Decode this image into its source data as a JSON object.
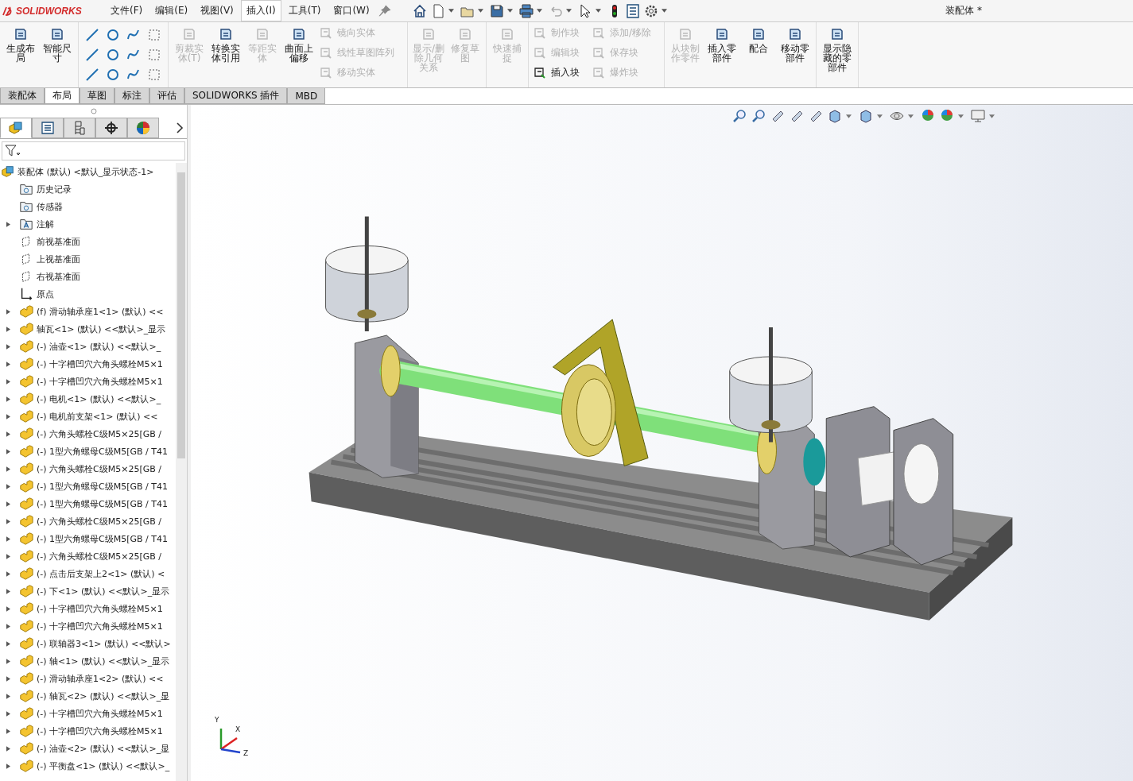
{
  "app": {
    "logo": "SOLIDWORKS"
  },
  "menu": [
    {
      "label": "文件(F)",
      "selected": false
    },
    {
      "label": "编辑(E)",
      "selected": false
    },
    {
      "label": "视图(V)",
      "selected": false
    },
    {
      "label": "插入(I)",
      "selected": true
    },
    {
      "label": "工具(T)",
      "selected": false
    },
    {
      "label": "窗口(W)",
      "selected": false
    }
  ],
  "document_title": "装配体 *",
  "ribbon": {
    "groups": [
      {
        "kind": "large",
        "tools": [
          {
            "label": "生成布局",
            "disabled": false
          },
          {
            "label": "智能尺寸",
            "disabled": false
          }
        ]
      },
      {
        "kind": "sketch"
      },
      {
        "kind": "large",
        "tools": [
          {
            "label": "剪裁实体(T)",
            "disabled": true
          },
          {
            "label": "转换实体引用",
            "disabled": false
          },
          {
            "label": "等距实体",
            "disabled": true
          },
          {
            "label": "曲面上偏移",
            "disabled": false
          }
        ],
        "small_tools": [
          [
            {
              "label": "镜向实体",
              "disabled": true
            },
            {
              "label": "线性草图阵列",
              "disabled": true
            },
            {
              "label": "移动实体",
              "disabled": true
            }
          ]
        ]
      },
      {
        "kind": "large",
        "tools": [
          {
            "label": "显示/删除几何关系",
            "disabled": true
          },
          {
            "label": "修复草图",
            "disabled": true
          }
        ]
      },
      {
        "kind": "large",
        "tools": [
          {
            "label": "快速捕捉",
            "disabled": true
          }
        ]
      },
      {
        "kind": "small",
        "small_tools": [
          [
            {
              "label": "制作块",
              "disabled": true
            },
            {
              "label": "编辑块",
              "disabled": true
            },
            {
              "label": "插入块",
              "disabled": false
            }
          ],
          [
            {
              "label": "添加/移除",
              "disabled": true
            },
            {
              "label": "保存块",
              "disabled": true
            },
            {
              "label": "爆炸块",
              "disabled": true
            }
          ]
        ]
      },
      {
        "kind": "large",
        "tools": [
          {
            "label": "从块制作零件",
            "disabled": true
          },
          {
            "label": "插入零部件",
            "disabled": false
          },
          {
            "label": "配合",
            "disabled": false
          },
          {
            "label": "移动零部件",
            "disabled": false
          }
        ]
      },
      {
        "kind": "large",
        "tools": [
          {
            "label": "显示隐藏的零部件",
            "disabled": false
          }
        ]
      }
    ]
  },
  "command_tabs": [
    {
      "label": "装配体",
      "selected": false
    },
    {
      "label": "布局",
      "selected": true
    },
    {
      "label": "草图",
      "selected": false
    },
    {
      "label": "标注",
      "selected": false
    },
    {
      "label": "评估",
      "selected": false
    },
    {
      "label": "SOLIDWORKS 插件",
      "selected": false
    },
    {
      "label": "MBD",
      "selected": false
    }
  ],
  "panel_tabs": [
    {
      "selected": true
    },
    {
      "selected": false
    },
    {
      "selected": false
    },
    {
      "selected": false
    },
    {
      "selected": false
    }
  ],
  "tree": {
    "label": "装配体 (默认) <默认_显示状态-1>",
    "children": [
      {
        "kind": "folder",
        "label": "历史记录",
        "expandable": false
      },
      {
        "kind": "folder",
        "label": "传感器",
        "expandable": false
      },
      {
        "kind": "annotation",
        "label": "注解",
        "expandable": true
      },
      {
        "kind": "plane",
        "label": "前视基准面",
        "expandable": false
      },
      {
        "kind": "plane",
        "label": "上视基准面",
        "expandable": false
      },
      {
        "kind": "plane",
        "label": "右视基准面",
        "expandable": false
      },
      {
        "kind": "origin",
        "label": "原点",
        "expandable": false
      },
      {
        "kind": "component",
        "label": "(f) 滑动轴承座1<1> (默认) <<",
        "expandable": true
      },
      {
        "kind": "component",
        "label": "轴瓦<1> (默认) <<默认>_显示",
        "expandable": true
      },
      {
        "kind": "component",
        "label": "(-) 油壶<1> (默认) <<默认>_",
        "expandable": true
      },
      {
        "kind": "component",
        "label": "(-) 十字槽凹穴六角头螺栓M5×1",
        "expandable": true
      },
      {
        "kind": "component",
        "label": "(-) 十字槽凹穴六角头螺栓M5×1",
        "expandable": true
      },
      {
        "kind": "component",
        "label": "(-) 电机<1> (默认) <<默认>_",
        "expandable": true
      },
      {
        "kind": "component",
        "label": "(-) 电机前支架<1> (默认) <<",
        "expandable": true
      },
      {
        "kind": "component",
        "label": "(-) 六角头螺栓C级M5×25[GB /",
        "expandable": true
      },
      {
        "kind": "component",
        "label": "(-) 1型六角螺母C级M5[GB / T41",
        "expandable": true
      },
      {
        "kind": "component",
        "label": "(-) 六角头螺栓C级M5×25[GB /",
        "expandable": true
      },
      {
        "kind": "component",
        "label": "(-) 1型六角螺母C级M5[GB / T41",
        "expandable": true
      },
      {
        "kind": "component",
        "label": "(-) 1型六角螺母C级M5[GB / T41",
        "expandable": true
      },
      {
        "kind": "component",
        "label": "(-) 六角头螺栓C级M5×25[GB /",
        "expandable": true
      },
      {
        "kind": "component",
        "label": "(-) 1型六角螺母C级M5[GB / T41",
        "expandable": true
      },
      {
        "kind": "component",
        "label": "(-) 六角头螺栓C级M5×25[GB /",
        "expandable": true
      },
      {
        "kind": "component",
        "label": "(-) 点击后支架上2<1> (默认) <",
        "expandable": true
      },
      {
        "kind": "component",
        "label": "(-) 下<1> (默认) <<默认>_显示",
        "expandable": true
      },
      {
        "kind": "component",
        "label": "(-) 十字槽凹穴六角头螺栓M5×1",
        "expandable": true
      },
      {
        "kind": "component",
        "label": "(-) 十字槽凹穴六角头螺栓M5×1",
        "expandable": true
      },
      {
        "kind": "component",
        "label": "(-) 联轴器3<1> (默认) <<默认>",
        "expandable": true
      },
      {
        "kind": "component",
        "label": "(-) 轴<1> (默认) <<默认>_显示",
        "expandable": true
      },
      {
        "kind": "component",
        "label": "(-) 滑动轴承座1<2> (默认) <<",
        "expandable": true
      },
      {
        "kind": "component",
        "label": "(-) 轴瓦<2> (默认) <<默认>_显",
        "expandable": true
      },
      {
        "kind": "component",
        "label": "(-) 十字槽凹穴六角头螺栓M5×1",
        "expandable": true
      },
      {
        "kind": "component",
        "label": "(-) 十字槽凹穴六角头螺栓M5×1",
        "expandable": true
      },
      {
        "kind": "component",
        "label": "(-) 油壶<2> (默认) <<默认>_显",
        "expandable": true
      },
      {
        "kind": "component",
        "label": "(-) 平衡盘<1> (默认) <<默认>_",
        "expandable": true
      }
    ]
  },
  "triad": {
    "x": "X",
    "y": "Y",
    "z": "Z"
  }
}
